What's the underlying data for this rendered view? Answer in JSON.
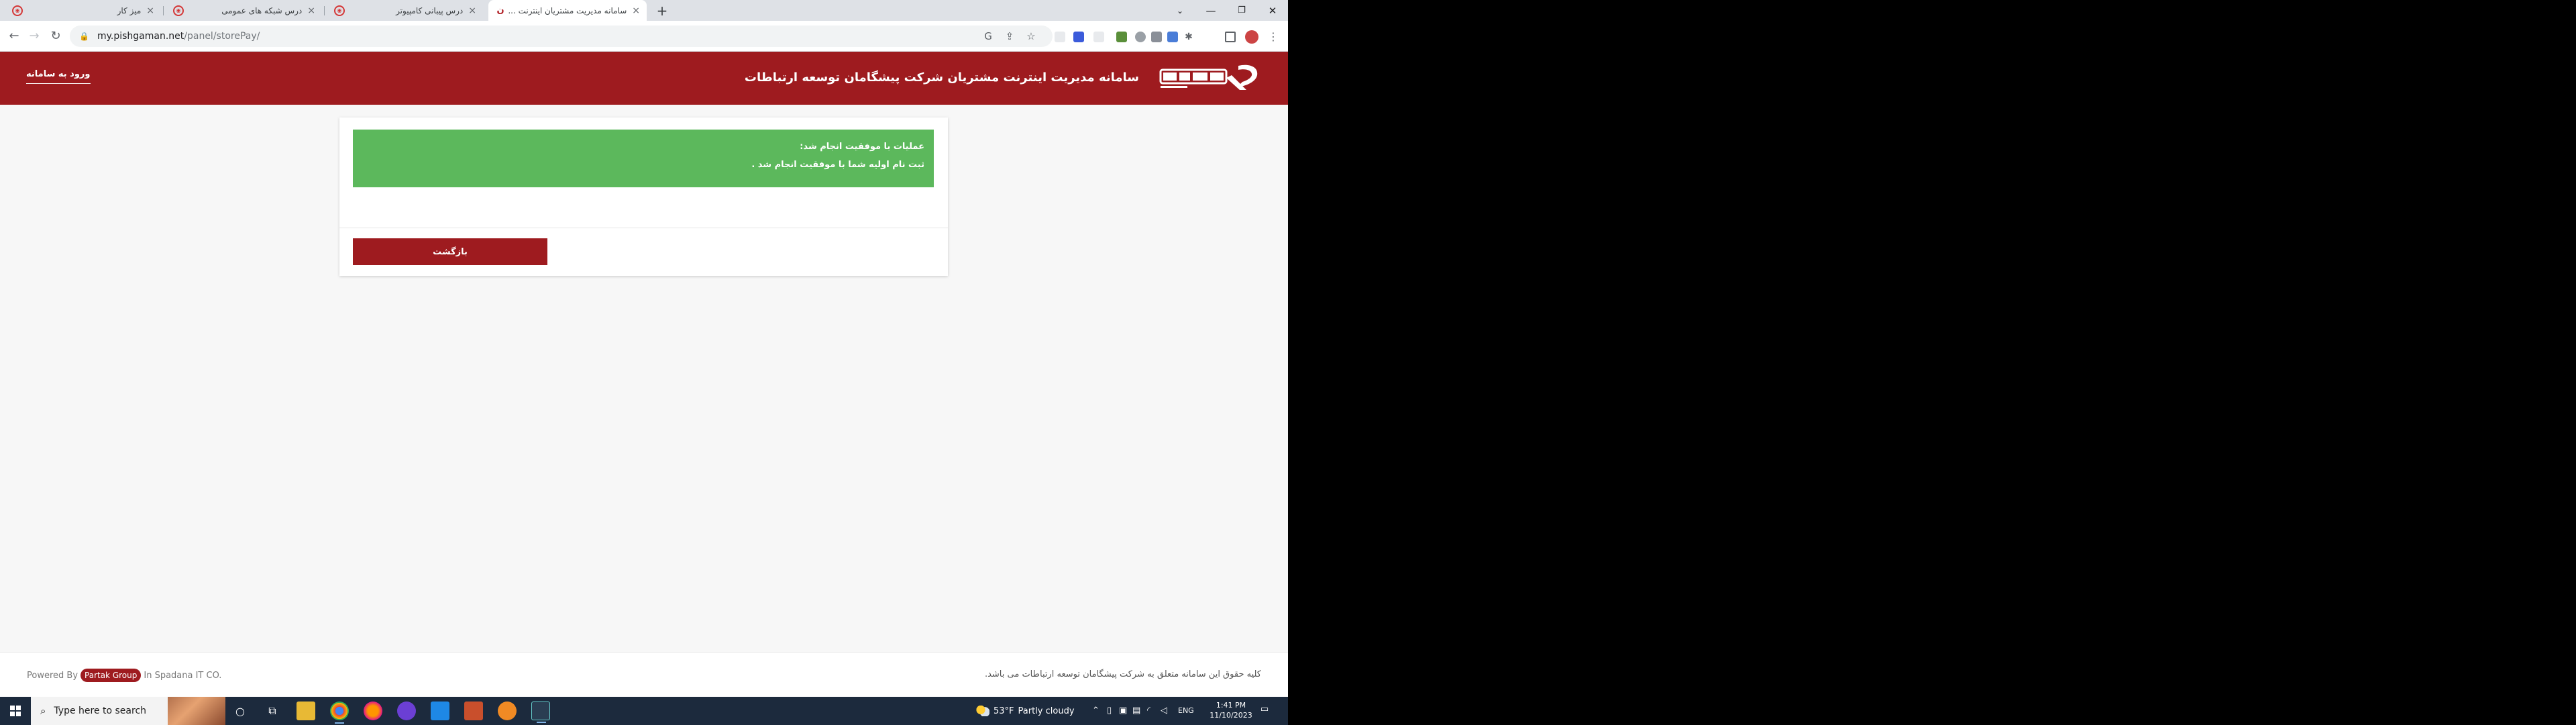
{
  "browser": {
    "tabs": [
      {
        "title": "میز کار",
        "active": false
      },
      {
        "title": "درس شبکه های عمومی",
        "active": false
      },
      {
        "title": "درس پیبانی کامپیوتر",
        "active": false
      },
      {
        "title": "سامانه مدیریت مشتریان اینترنت ...",
        "active": true
      }
    ],
    "close_glyph": "×",
    "new_tab_glyph": "+",
    "window_controls": {
      "minimize": "⌄",
      "min": "—",
      "max": "❐",
      "close": "✕"
    },
    "url_host": "my.pishgaman.net",
    "url_path": "/panel/storePay/"
  },
  "site": {
    "title": "سامانه مدیریت اینترنت مشتریان شرکت پیشگامان توسعه ارتباطات",
    "login_link": "ورود به سامانه",
    "brand_color": "#9e1b1f"
  },
  "alert": {
    "line1": "عملیات با موفقیت انجام شد:",
    "line2": "ثبت نام اولیه شما با موفقیت انجام شد .",
    "color": "#5cb85c"
  },
  "back_button": "بازگشت",
  "footer": {
    "powered_prefix": "Powered By",
    "powered_badge": "Partak Group",
    "powered_suffix": "In Spadana IT CO.",
    "copyright": "کلیه حقوق این سامانه متعلق به شرکت پیشگامان توسعه ارتباطات می باشد."
  },
  "taskbar": {
    "search_placeholder": "Type here to search",
    "weather_temp": "53°F",
    "weather_text": "Partly cloudy",
    "language": "ENG",
    "time": "1:41 PM",
    "date": "11/10/2023"
  }
}
